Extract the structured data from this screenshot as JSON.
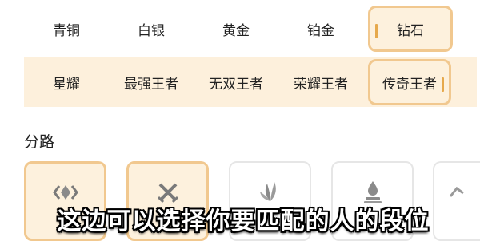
{
  "ranks_row1": [
    "青铜",
    "白银",
    "黄金",
    "铂金",
    "钻石"
  ],
  "ranks_row2": [
    "星耀",
    "最强王者",
    "无双王者",
    "荣耀王者",
    "传奇王者"
  ],
  "selected_ranks": [
    "钻石",
    "传奇王者"
  ],
  "section": {
    "title": "分路"
  },
  "positions": [
    {
      "label": "全",
      "icon": "all-lanes-icon",
      "selected": true
    },
    {
      "label": "",
      "icon": "crossed-swords-icon",
      "selected": true
    },
    {
      "label": "",
      "icon": "leaf-icon",
      "selected": false
    },
    {
      "label": "",
      "icon": "stacked-drop-icon",
      "selected": false
    },
    {
      "label": "",
      "icon": "partial-icon",
      "selected": false
    }
  ],
  "subtitle": "这边可以选择你要匹配的人的段位",
  "colors": {
    "accent_border": "#f1c88f",
    "selected_bg": "#fdf1dd",
    "row_bg": "#fdf0dc",
    "accent_bar": "#e6a94c"
  }
}
